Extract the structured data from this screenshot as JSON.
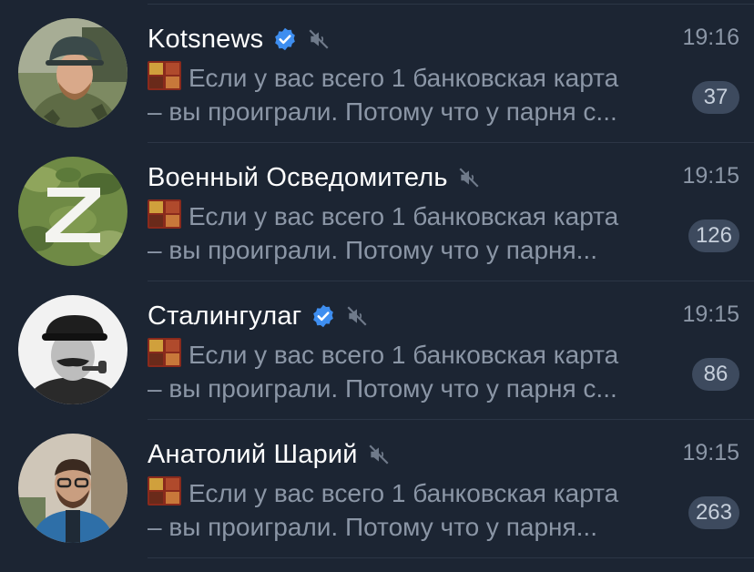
{
  "chats": [
    {
      "name": "Kotsnews",
      "verified": true,
      "muted": true,
      "time": "19:16",
      "preview_line1": "Если у вас всего 1 банковская карта",
      "preview_line2": "– вы проиграли. Потому что у парня с...",
      "unread": "37",
      "avatar": "soldier-with-helmet-photo"
    },
    {
      "name": "Военный Осведомитель",
      "verified": false,
      "muted": true,
      "time": "19:15",
      "preview_line1": "Если у вас всего 1 банковская карта",
      "preview_line2": "– вы проиграли. Потому что у парня...",
      "unread": "126",
      "avatar": "white-z-on-camouflage"
    },
    {
      "name": "Сталингулаг",
      "verified": true,
      "muted": true,
      "time": "19:15",
      "preview_line1": "Если у вас всего 1 банковская карта",
      "preview_line2": "– вы проиграли. Потому что у парня с...",
      "unread": "86",
      "avatar": "black-and-white-portrait-with-pipe"
    },
    {
      "name": "Анатолий Шарий",
      "verified": false,
      "muted": true,
      "time": "19:15",
      "preview_line1": "Если у вас всего 1 банковская карта",
      "preview_line2": "– вы проиграли. Потому что у парня...",
      "unread": "263",
      "avatar": "man-with-glasses-outdoor-photo"
    }
  ],
  "colors": {
    "background": "#1c2533",
    "divider": "#2c3646",
    "secondary_text": "#8b96a6",
    "badge_bg": "#3d4a5e",
    "verified_blue": "#3e8ef0"
  }
}
